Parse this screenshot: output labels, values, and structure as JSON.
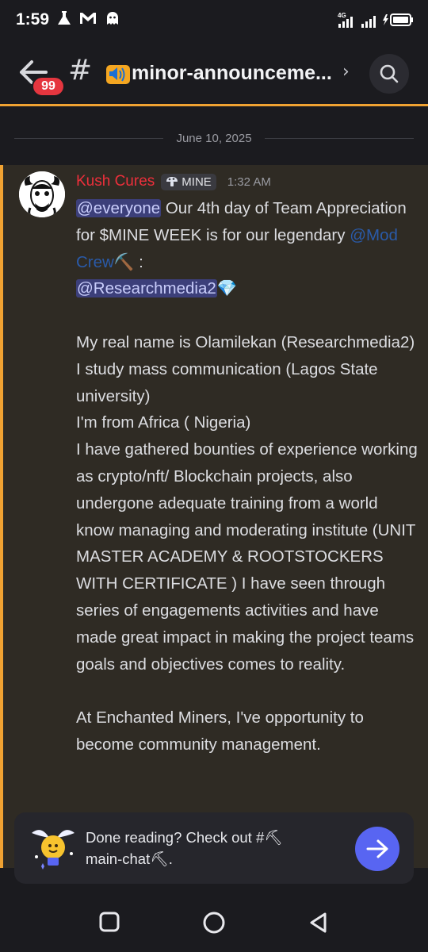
{
  "status_bar": {
    "time": "1:59",
    "icons": [
      "flask-icon",
      "gmail-icon",
      "ghost-icon"
    ],
    "network": "4G",
    "right_icons": [
      "signal-icon",
      "signal-icon",
      "battery-charging-icon"
    ]
  },
  "header": {
    "unread_badge": "99",
    "channel_prefix": "#",
    "channel_name": "minor-announceme...",
    "chevron": "›"
  },
  "messages": {
    "date_separator": "June 10, 2025",
    "message": {
      "author": "Kush Cures",
      "role_tag": "MINE",
      "time": "1:32 AM",
      "mention_everyone": "@everyone",
      "line1_rest": " Our 4th day of Team Appreciation for $MINE WEEK is for our legendary ",
      "mention_role": "@Mod Crew",
      "role_emoji": "⛏️",
      "after_role": " :",
      "mention_user": "@Researchmedia2",
      "user_emoji": "💎",
      "para2": "My real name is Olamilekan (Researchmedia2)",
      "para3": "I study mass communication (Lagos State university)",
      "para4": "I'm from Africa ( Nigeria)",
      "para5": "I have gathered bounties of experience working as crypto/nft/ Blockchain projects, also undergone adequate training from a world know managing and moderating institute (UNIT MASTER ACADEMY & ROOTSTOCKERS WITH CERTIFICATE  ) I have seen through series of engagements activities and have made great impact in making the project teams goals and objectives comes to reality.",
      "para6": "At Enchanted Miners, I've opportunity to become community management."
    }
  },
  "banner": {
    "text_line1": "Done reading? Check out #⛏",
    "text_line2": "main-chat⛏."
  },
  "navbar": {
    "buttons": [
      "recents-button",
      "home-button",
      "back-button"
    ]
  }
}
